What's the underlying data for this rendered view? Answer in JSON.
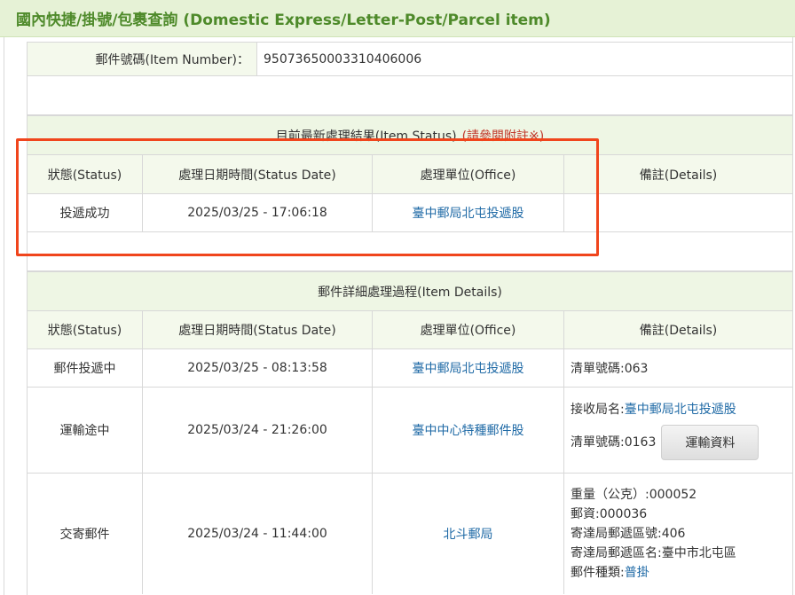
{
  "header": {
    "title": "國內快捷/掛號/包裹查詢 (Domestic Express/Letter-Post/Parcel item)"
  },
  "item_number": {
    "label": "郵件號碼(Item Number)：",
    "value": "95073650003310406006"
  },
  "current_status": {
    "title": "目前最新處理結果(Item Status)",
    "title_note": "(請參閱附註※)",
    "columns": [
      "狀態(Status)",
      "處理日期時間(Status Date)",
      "處理單位(Office)",
      "備註(Details)"
    ],
    "row": {
      "status": "投遞成功",
      "date": "2025/03/25 - 17:06:18",
      "office": "臺中郵局北屯投遞股",
      "details": ""
    }
  },
  "details": {
    "title": "郵件詳細處理過程(Item Details)",
    "columns": [
      "狀態(Status)",
      "處理日期時間(Status Date)",
      "處理單位(Office)",
      "備註(Details)"
    ],
    "rows": [
      {
        "status": "郵件投遞中",
        "date": "2025/03/25 - 08:13:58",
        "office": "臺中郵局北屯投遞股",
        "note1_label": "清單號碼:063"
      },
      {
        "status": "運輸途中",
        "date": "2025/03/24 - 21:26:00",
        "office": "臺中中心特種郵件股",
        "note1_label": "接收局名:",
        "note1_link": "臺中郵局北屯投遞股",
        "note2_label": "清單號碼:0163",
        "button": "運輸資料"
      },
      {
        "status": "交寄郵件",
        "date": "2025/03/24 - 11:44:00",
        "office": "北斗郵局",
        "lines": [
          "重量（公克）:000052",
          "郵資:000036",
          "寄達局郵遞區號:406",
          "寄達局郵遞區名:臺中市北屯區"
        ],
        "type_label": "郵件種類:",
        "type_link": "普掛"
      }
    ]
  },
  "colors": {
    "header_bg": "#e6f2d6",
    "header_text": "#4e8a2a",
    "link": "#1f6aa6",
    "highlight_box": "#f0451c"
  }
}
